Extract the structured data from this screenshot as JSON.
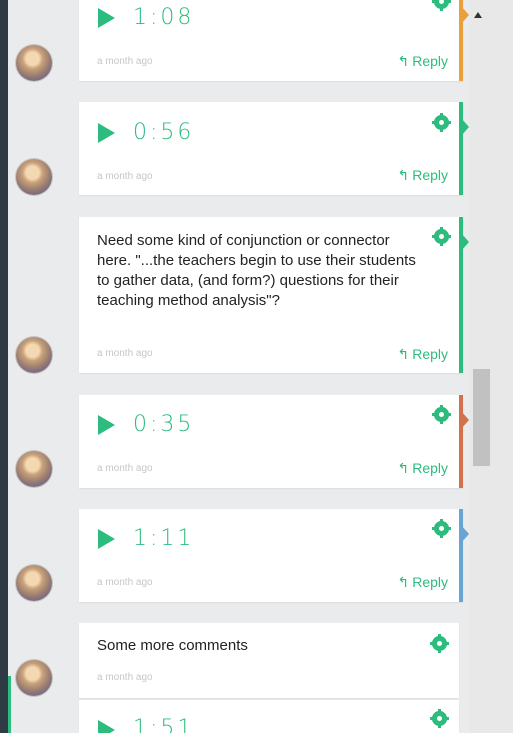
{
  "colors": {
    "accent": "#2cbc7d",
    "orange": "#e9a03a",
    "terracotta": "#d2714d",
    "blue": "#69a5d3"
  },
  "comments": [
    {
      "kind": "audio",
      "duration": "1:08",
      "time": "a month ago",
      "reply_label": "Reply",
      "color": "#e9a03a"
    },
    {
      "kind": "audio",
      "duration": "0:56",
      "time": "a month ago",
      "reply_label": "Reply",
      "color": "#2cbc7d"
    },
    {
      "kind": "text",
      "text": "Need some kind of conjunction or connector here.  \"...the teachers begin to use their students to gather data, (and form?) questions for their teaching method analysis\"?",
      "time": "a month ago",
      "reply_label": "Reply",
      "color": "#2cbc7d"
    },
    {
      "kind": "audio",
      "duration": "0:35",
      "time": "a month ago",
      "reply_label": "Reply",
      "color": "#d2714d"
    },
    {
      "kind": "audio",
      "duration": "1:11",
      "time": "a month ago",
      "reply_label": "Reply",
      "color": "#69a5d3"
    },
    {
      "kind": "text",
      "text": "Some more comments",
      "time": "a month ago"
    },
    {
      "kind": "audio",
      "duration": "1:51"
    }
  ],
  "icons": {
    "play": "play-icon",
    "settings": "gear-icon",
    "reply": "reply-icon",
    "scroll_up": "scroll-up-arrow-icon"
  }
}
